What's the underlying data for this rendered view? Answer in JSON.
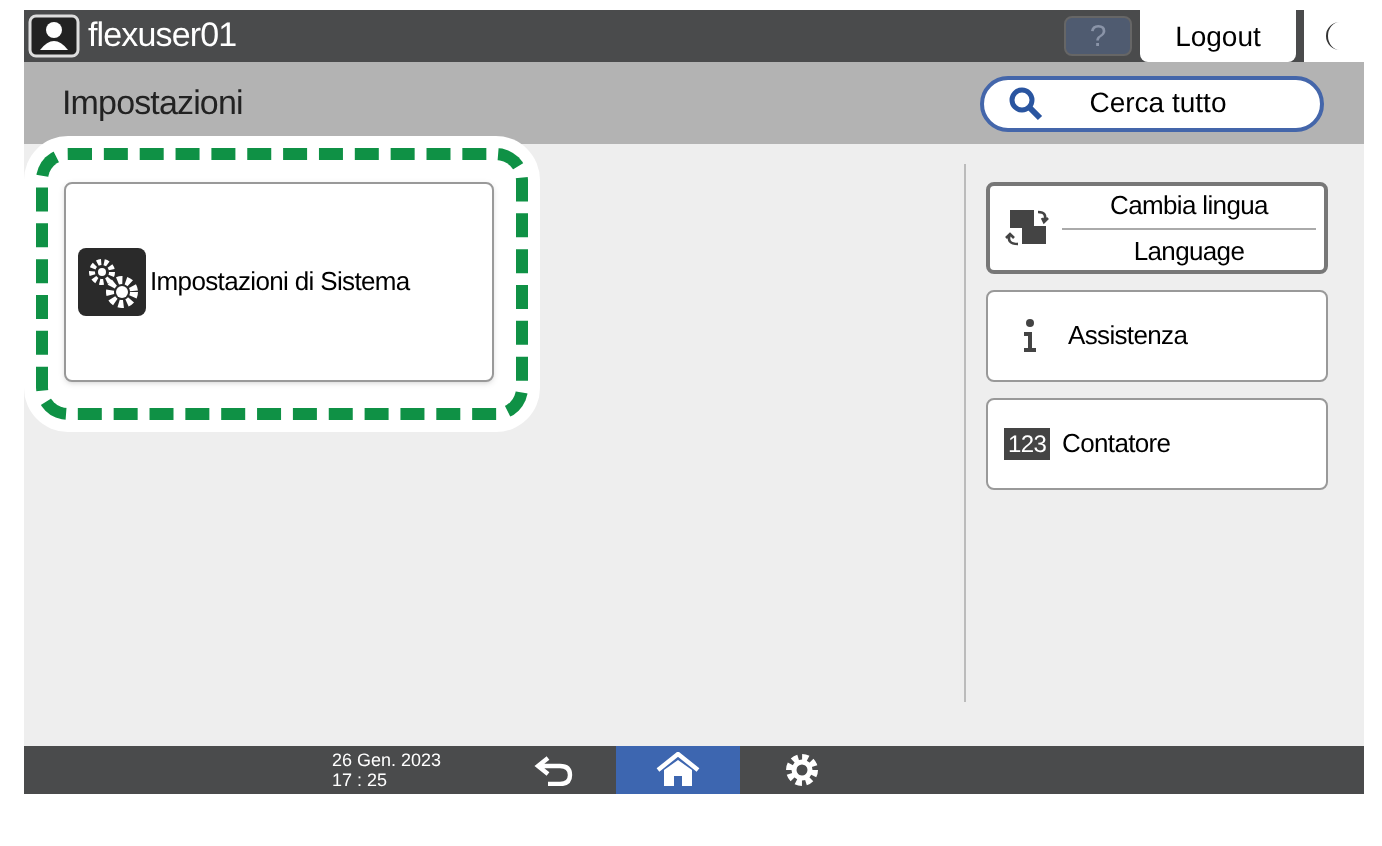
{
  "top_bar": {
    "user": "flexuser01",
    "help": "?",
    "logout": "Logout"
  },
  "header": {
    "title": "Impostazioni",
    "search": "Cerca tutto"
  },
  "main_tile": {
    "label": "Impostazioni di Sistema",
    "highlighted": true
  },
  "side_buttons": [
    {
      "kind": "language",
      "label": "Cambia lingua",
      "sublabel": "Language"
    },
    {
      "kind": "info",
      "label": "Assistenza"
    },
    {
      "kind": "counter",
      "label": "Contatore",
      "badge": "123"
    }
  ],
  "bottom_bar": {
    "date": "26 Gen. 2023",
    "time": "17 : 25",
    "nav": [
      {
        "kind": "back",
        "selected": false
      },
      {
        "kind": "home",
        "selected": true
      },
      {
        "kind": "settings",
        "selected": false
      }
    ]
  }
}
